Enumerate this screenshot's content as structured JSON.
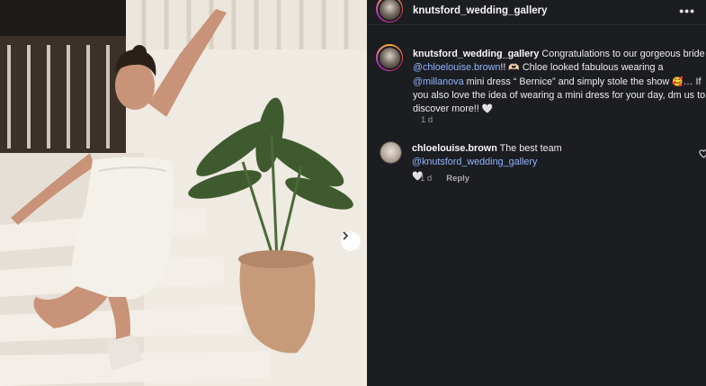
{
  "post": {
    "account": "knutsford_wedding_gallery",
    "more_label": "•••",
    "next_label": "›"
  },
  "caption": {
    "username": "knutsford_wedding_gallery",
    "part1": " Congratulations to our gorgeous bride ",
    "mention1": "@chloelouise.brown",
    "part2": "!! ",
    "emoji1": "🫶🏻",
    "part3": " Chloe looked fabulous wearing a ",
    "mention2": "@millanova",
    "part4": " mini dress “ Bernice” and simply stole the show ",
    "emoji2": "🥰",
    "part5": "… If you also love the idea of wearing a mini dress for your day, dm us to discover more!! ",
    "emoji3": "🤍",
    "time": "1 d"
  },
  "comment": {
    "username": "chloelouise.brown",
    "part1": " The best team ",
    "mention": "@knutsford_wedding_gallery",
    "emoji": "🤍",
    "time": "1 d",
    "reply_label": "Reply"
  },
  "colors": {
    "panel_bg": "#1c1d21",
    "mention": "#8eb4ff",
    "story_ring": [
      "#f6b036",
      "#e6346b",
      "#b72fd1"
    ]
  },
  "icons": [
    "more-options-icon",
    "heart-outline-icon",
    "chevron-right-icon"
  ]
}
